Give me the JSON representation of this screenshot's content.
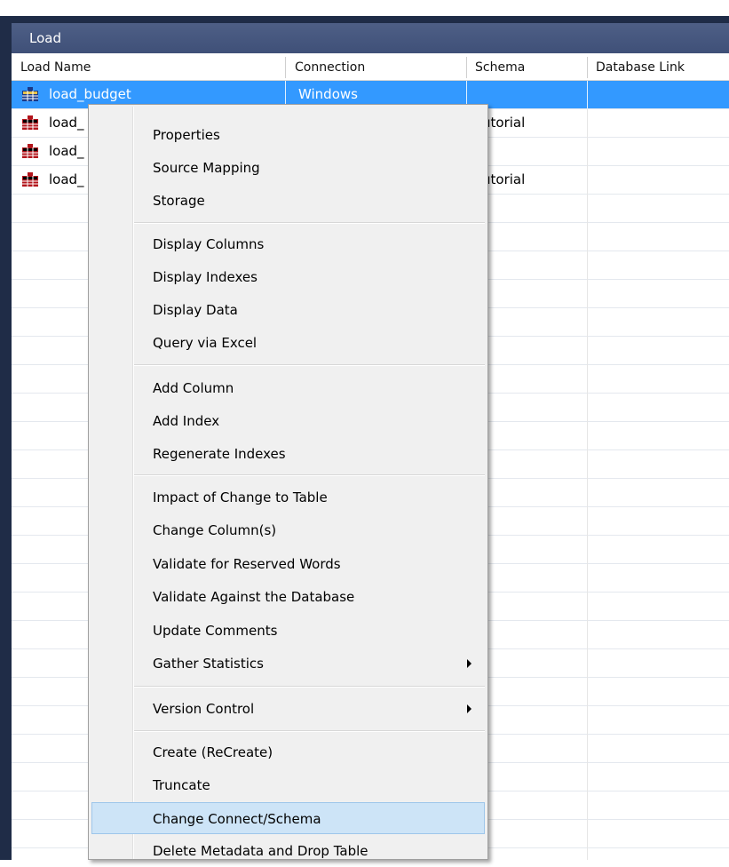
{
  "window": {
    "title": "Load"
  },
  "columns": [
    "Load Name",
    "Connection",
    "Schema",
    "Database Link"
  ],
  "rows": [
    {
      "name": "load_budget",
      "connection": "Windows",
      "schema": "",
      "db_link": "",
      "selected": true
    },
    {
      "name": "load_",
      "connection": "",
      "schema": "utorial",
      "db_link": "",
      "selected": false
    },
    {
      "name": "load_",
      "connection": "",
      "schema": "",
      "db_link": "",
      "selected": false
    },
    {
      "name": "load_",
      "connection": "",
      "schema": "utorial",
      "db_link": "",
      "selected": false
    }
  ],
  "context_menu": {
    "items": [
      "Properties",
      "Source Mapping",
      "Storage",
      "Display Columns",
      "Display Indexes",
      "Display Data",
      "Query via Excel",
      "Add Column",
      "Add Index",
      "Regenerate Indexes",
      "Impact of Change to Table",
      "Change Column(s)",
      "Validate for Reserved Words",
      "Validate Against the Database",
      "Update Comments",
      "Gather Statistics",
      "Version Control",
      "Create (ReCreate)",
      "Truncate",
      "Change Connect/Schema",
      "Delete Metadata and Drop Table"
    ],
    "highlighted": "Change Connect/Schema"
  },
  "colors": {
    "selection": "#3399ff",
    "title_bar": "#4e5f86",
    "menu_hover": "#cde4f7"
  }
}
